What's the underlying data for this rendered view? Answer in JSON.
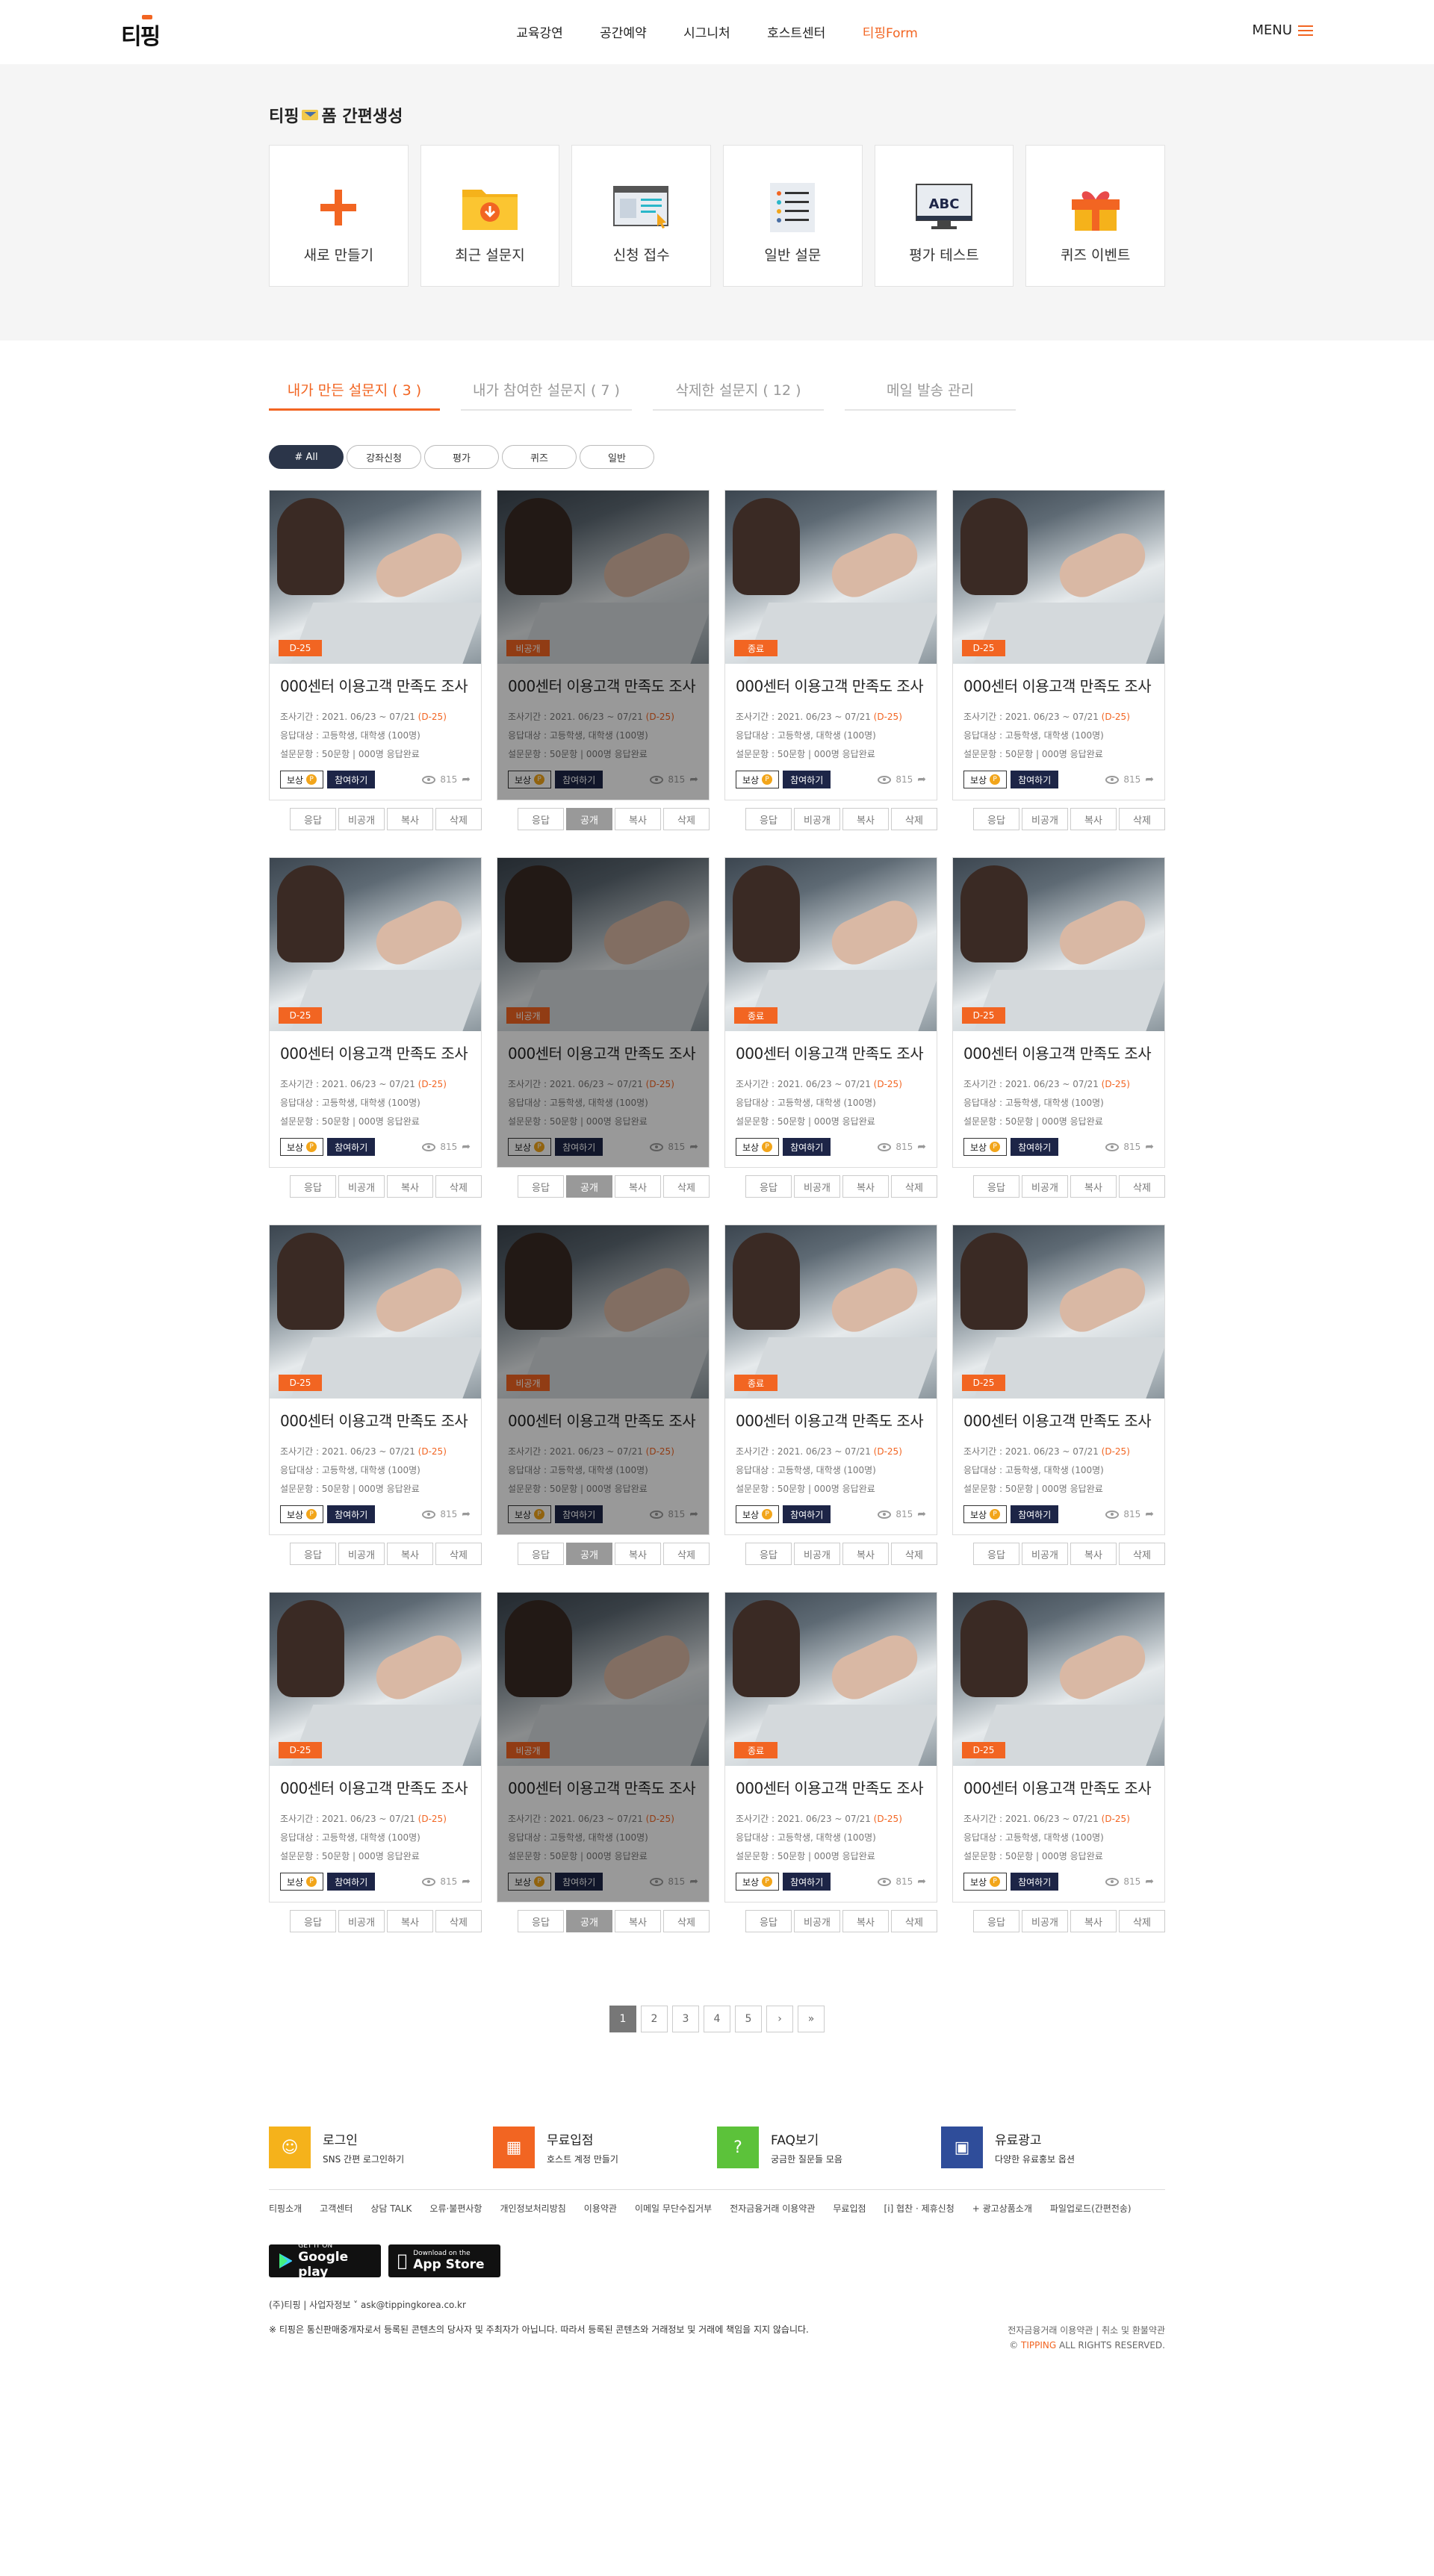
{
  "header": {
    "logo": "티핑",
    "nav": [
      "교육강연",
      "공간예약",
      "시그니처",
      "호스트센터",
      "티핑Form"
    ],
    "menu_label": "MENU"
  },
  "quick": {
    "title_pre": "티핑",
    "title_post": "폼 간편생성",
    "cards": [
      "새로 만들기",
      "최근 설문지",
      "신청 접수",
      "일반 설문",
      "평가 테스트",
      "퀴즈 이벤트"
    ]
  },
  "tabs": [
    "내가 만든 설문지 ( 3 )",
    "내가 참여한 설문지 ( 7 )",
    "삭제한 설문지 ( 12 )",
    "메일 발송 관리"
  ],
  "filters": [
    "# All",
    "강좌신청",
    "평가",
    "퀴즈",
    "일반"
  ],
  "card": {
    "title": "000센터 이용고객 만족도 조사",
    "period_prefix": "조사기간 : 2021. 06/23 ~ 07/21 ",
    "dday": "(D-25)",
    "target": "응답대상 : 고등학생, 대학생 (100명)",
    "questions": "설문문항 : 50문항  |  000명 응답완료",
    "reward": "보상",
    "join": "참여하기",
    "views": "815",
    "ops": [
      "응답",
      "비공개",
      "복사",
      "삭제"
    ],
    "ops_off": [
      "응답",
      "공개",
      "복사",
      "삭제"
    ]
  },
  "card_badges": [
    "D-25",
    "비공개",
    "종료",
    "D-25"
  ],
  "pagination": [
    "1",
    "2",
    "3",
    "4",
    "5",
    "›",
    "»"
  ],
  "footer": {
    "links": [
      {
        "title": "로그인",
        "sub": "SNS 간편 로그인하기"
      },
      {
        "title": "무료입점",
        "sub": "호스트 계정 만들기"
      },
      {
        "title": "FAQ보기",
        "sub": "궁금한 질문들 모음"
      },
      {
        "title": "유료광고",
        "sub": "다양한 유료홍보 옵션"
      }
    ],
    "nav": [
      "티핑소개",
      "고객센터",
      "상담 TALK",
      "오류·불편사항",
      "개인정보처리방침",
      "이용약관",
      "이메일 무단수집거부",
      "전자금융거래 이용약관",
      "무료입점",
      "[i] 협찬 · 제휴신청",
      "+ 광고상품소개",
      "파일업로드(간편전송)"
    ],
    "google_small": "GET IT ON",
    "google": "Google play",
    "apple_small": "Download on the",
    "apple": "App Store",
    "company": "(주)티핑  |  사업자정보 ˅   ask@tippingkorea.co.kr",
    "disclaimer": "※ 티핑은 통신판매중개자로서 등록된 콘텐츠의 당사자 및 주최자가 아닙니다. 따라서 등록된 콘텐츠와 거래정보 및 거래에 책임을 지지 않습니다.",
    "legal": "전자금융거래 이용약관  |  취소 및 환불약관",
    "copyright_pre": "© ",
    "copyright_brand": "TIPPING",
    "copyright_post": " ALL RIGHTS RESERVED."
  },
  "colors": {
    "accent": "#f26522",
    "navy": "#1d2547",
    "filter_active": "#2b3549"
  }
}
